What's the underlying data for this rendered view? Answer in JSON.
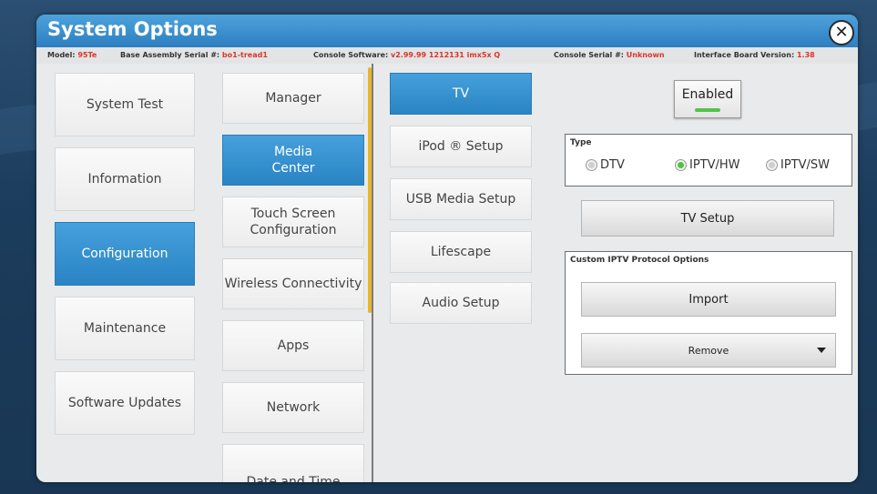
{
  "window": {
    "title": "System Options",
    "close_label": "✕"
  },
  "info": {
    "model_label": "Model:",
    "model_value": "95Te",
    "assembly_label": "Base Assembly Serial #:",
    "assembly_value": "bo1-tread1",
    "software_label": "Console Software:",
    "software_value": "v2.99.99 1212131 imx5x Q",
    "console_serial_label": "Console Serial #:",
    "console_serial_value": "Unknown",
    "interface_label": "Interface Board Version:",
    "interface_value": "1.38"
  },
  "menu_main": {
    "items": [
      {
        "label": "System Test"
      },
      {
        "label": "Information"
      },
      {
        "label": "Configuration"
      },
      {
        "label": "Maintenance"
      },
      {
        "label": "Software Updates"
      }
    ],
    "selected": "Configuration"
  },
  "menu_config": {
    "items": [
      {
        "label": "Manager"
      },
      {
        "label": "Media\nCenter"
      },
      {
        "label": "Touch Screen\nConfiguration"
      },
      {
        "label": "Wireless Connectivity"
      },
      {
        "label": "Apps"
      },
      {
        "label": "Network"
      },
      {
        "label": "Date and Time"
      }
    ],
    "selected": "Media Center"
  },
  "menu_media": {
    "items": [
      {
        "label": "TV"
      },
      {
        "label": "iPod ® Setup"
      },
      {
        "label": "USB Media Setup"
      },
      {
        "label": "Lifescape"
      },
      {
        "label": "Audio Setup"
      }
    ],
    "selected": "TV"
  },
  "tv": {
    "enabled_label": "Enabled",
    "type_title": "Type",
    "type_options": [
      {
        "label": "DTV",
        "selected": false
      },
      {
        "label": "IPTV/HW",
        "selected": true
      },
      {
        "label": "IPTV/SW",
        "selected": false
      }
    ],
    "setup_label": "TV Setup",
    "custom_title": "Custom IPTV Protocol Options",
    "import_label": "Import",
    "remove_label": "Remove"
  },
  "colors": {
    "accent_blue": "#2d7fc0",
    "value_red": "#d9362b",
    "led_green": "#53c34a",
    "scroll_accent": "#e8b62a"
  }
}
